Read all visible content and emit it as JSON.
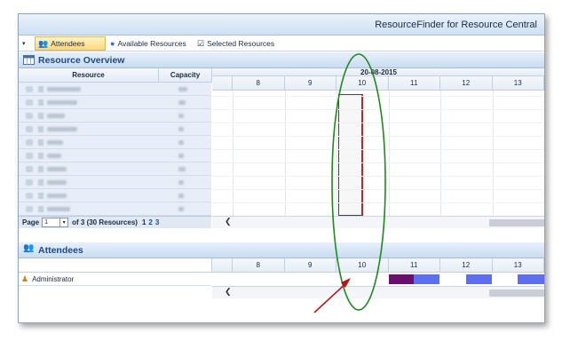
{
  "window": {
    "title": "ResourceFinder for Resource Central"
  },
  "toolbar": {
    "attendees_label": "Attendees",
    "available_label": "Available Resources",
    "selected_label": "Selected Resources"
  },
  "resource_overview": {
    "title": "Resource Overview",
    "col_resource": "Resource",
    "col_capacity": "Capacity",
    "date": "20-08-2015",
    "hours": [
      "8",
      "9",
      "10",
      "11",
      "12",
      "13"
    ],
    "row_count": 10
  },
  "pager": {
    "page_label": "Page",
    "page_value": "1",
    "of_text": "of 3 (30 Resources)",
    "pages": [
      "1",
      "2",
      "3"
    ]
  },
  "attendees": {
    "title": "Attendees",
    "hours": [
      "8",
      "9",
      "10",
      "11",
      "12",
      "13"
    ],
    "rows": [
      {
        "name": "Administrator"
      }
    ]
  },
  "colors": {
    "busy_dark": "#6a0f6e",
    "busy_light": "#5e6ef0",
    "highlight_line": "#c8202a",
    "annotation_oval": "#1e8a1e",
    "annotation_arrow": "#b3181e"
  }
}
